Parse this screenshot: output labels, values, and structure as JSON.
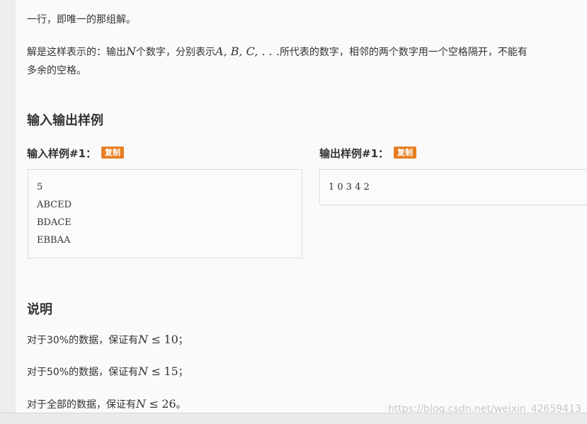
{
  "output_format": {
    "line1": "一行，即唯一的那组解。",
    "line2_prefix": "解是这样表示的：输出",
    "line2_var": "N",
    "line2_mid": "个数字，分别表示",
    "line2_vars": "A, B, C, . . .",
    "line2_suffix": "所代表的数字，相邻的两个数字用一个空格隔开，不能有",
    "line3": "多余的空格。"
  },
  "samples_section": {
    "title": "输入输出样例",
    "input_label": "输入样例#1：",
    "output_label": "输出样例#1：",
    "copy_label": "复制",
    "input_lines": [
      "5",
      "ABCED",
      "BDACE",
      "EBBAA"
    ],
    "output_lines": [
      "1 0 3 4 2"
    ]
  },
  "notes_section": {
    "title": "说明",
    "items": [
      {
        "prefix": "对于30%的数据，保证有",
        "var": "N",
        "op": "≤",
        "value": "10",
        "suffix": "；"
      },
      {
        "prefix": "对于50%的数据，保证有",
        "var": "N",
        "op": "≤",
        "value": "15",
        "suffix": "；"
      },
      {
        "prefix": "对于全部的数据，保证有",
        "var": "N",
        "op": "≤",
        "value": "26",
        "suffix": "。"
      }
    ]
  },
  "watermark": "https://blog.csdn.net/weixin_42659413"
}
